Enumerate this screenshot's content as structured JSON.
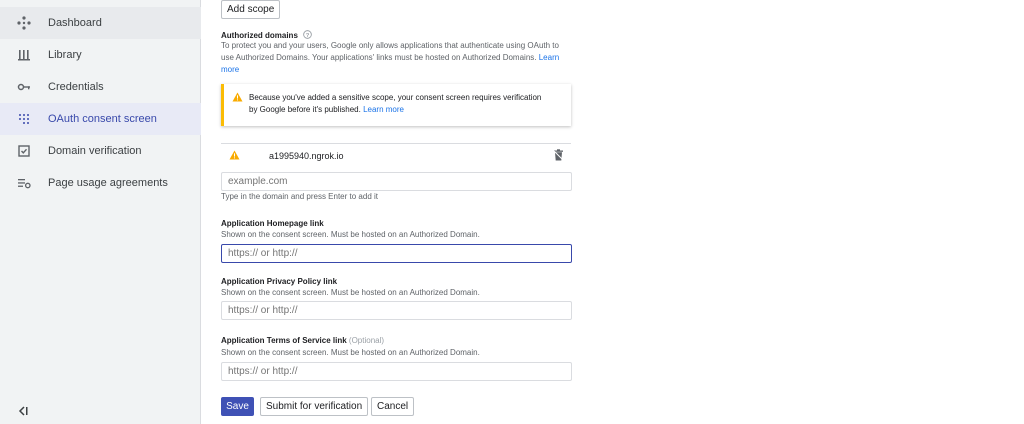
{
  "sidebar": {
    "items": [
      {
        "label": "Dashboard",
        "icon": "dashboard-icon"
      },
      {
        "label": "Library",
        "icon": "library-icon"
      },
      {
        "label": "Credentials",
        "icon": "key-icon"
      },
      {
        "label": "OAuth consent screen",
        "icon": "oauth-grid-icon"
      },
      {
        "label": "Domain verification",
        "icon": "checkbox-icon"
      },
      {
        "label": "Page usage agreements",
        "icon": "list-settings-icon"
      }
    ],
    "collapse_icon": "collapse-sidebar-icon"
  },
  "main": {
    "add_scope_label": "Add scope",
    "authorized_domains": {
      "title": "Authorized domains",
      "description": "To protect you and your users, Google only allows applications that authenticate using OAuth to use Authorized Domains. Your applications' links must be hosted on Authorized Domains.",
      "learn_more": "Learn more"
    },
    "alert": {
      "text": "Because you've added a sensitive scope, your consent screen requires verification by Google before it's published.",
      "learn_more": "Learn more"
    },
    "domain_entry": {
      "value": "a1995940.ngrok.io"
    },
    "domain_input": {
      "placeholder": "example.com",
      "hint": "Type in the domain and press Enter to add it"
    },
    "homepage": {
      "title": "Application Homepage link",
      "description": "Shown on the consent screen. Must be hosted on an Authorized Domain.",
      "placeholder": "https:// or http://"
    },
    "privacy": {
      "title": "Application Privacy Policy link",
      "description": "Shown on the consent screen. Must be hosted on an Authorized Domain.",
      "placeholder": "https:// or http://"
    },
    "terms": {
      "title": "Application Terms of Service link",
      "optional": "(Optional)",
      "description": "Shown on the consent screen. Must be hosted on an Authorized Domain.",
      "placeholder": "https:// or http://"
    },
    "buttons": {
      "save": "Save",
      "submit": "Submit for verification",
      "cancel": "Cancel"
    }
  },
  "colors": {
    "accent": "#3f51b5",
    "warning": "#fbbc04",
    "link": "#1a73e8"
  }
}
